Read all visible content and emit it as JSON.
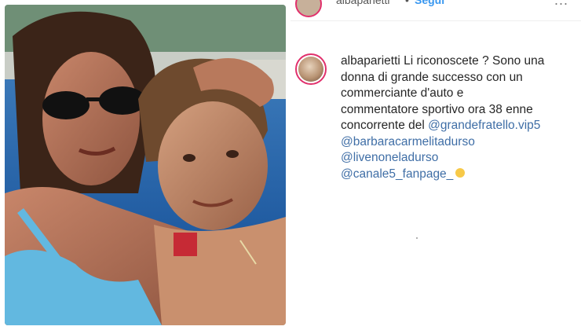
{
  "post": {
    "username": "albaparietti",
    "follow_label": "Segui",
    "dot": "•",
    "more_label": "..."
  },
  "caption": {
    "username": "albaparietti",
    "line1": "Li riconoscete ? Sono una",
    "line2": "donna di grande successo con un",
    "line3": "commerciante d'auto e",
    "line4": "commentatore sportivo ora 38 enne",
    "line5_text": "concorrente del ",
    "line5_link": "@grandefratello.vip5",
    "mentions": [
      "@barbaracarmelitadurso",
      "@livenoneladurso",
      "@canale5_fanpage_"
    ],
    "emoji": "smiling-face-emoji"
  },
  "colors": {
    "link": "#3f6ea6",
    "follow": "#3897f0",
    "ring": "#e1306c"
  },
  "photo": {
    "icon": "photo-woman-and-boy"
  }
}
